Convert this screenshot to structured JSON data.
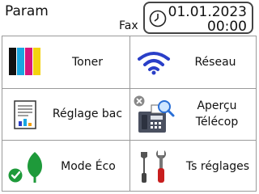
{
  "header": {
    "title": "Param",
    "fax_label": "Fax",
    "date": "01.01.2023",
    "time": "00:00"
  },
  "menu": [
    {
      "label": "Toner",
      "icon": "toner-cartridges-icon"
    },
    {
      "label": "Réseau",
      "icon": "wifi-icon"
    },
    {
      "label": "Réglage bac",
      "icon": "tray-settings-icon"
    },
    {
      "label": "Aperçu\nTélécop",
      "icon": "fax-preview-icon"
    },
    {
      "label": "Mode Éco",
      "icon": "eco-leaf-icon"
    },
    {
      "label": "Ts réglages",
      "icon": "tools-icon"
    }
  ],
  "colors": {
    "wifi_blue": "#2a3fc8",
    "eco_green": "#1e9a3a",
    "toner_black": "#111111",
    "toner_cyan": "#1aa7e0",
    "toner_magenta": "#d6167c",
    "toner_yellow": "#f4d20f"
  }
}
